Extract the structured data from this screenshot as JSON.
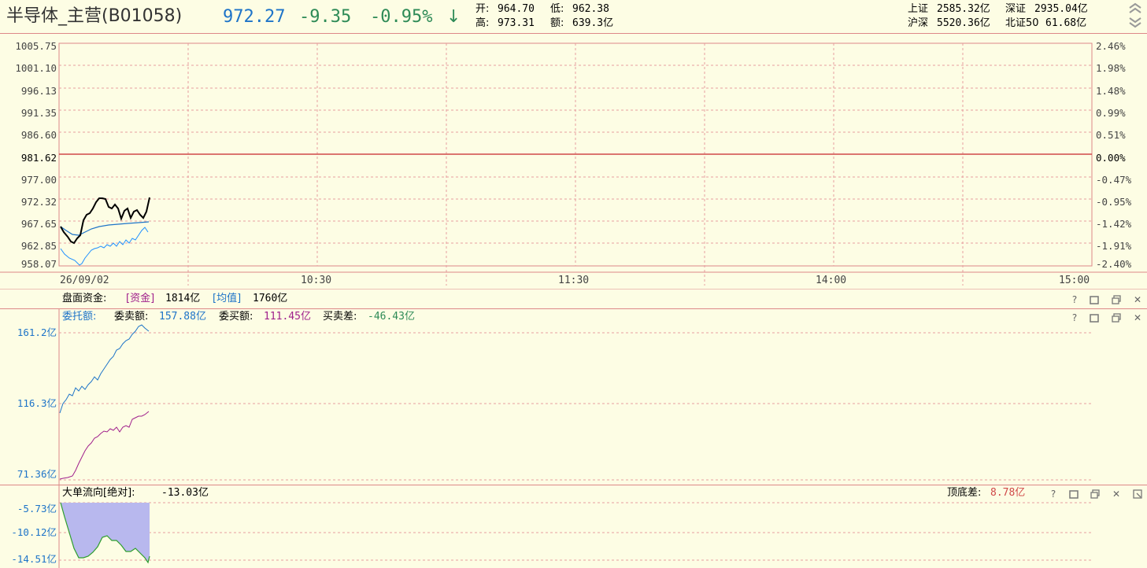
{
  "header": {
    "title": "半导体_主营(B01058)",
    "price": "972.27",
    "change": "-9.35",
    "pct": "-0.95%",
    "arrow": "↓",
    "open_label": "开:",
    "open_val": "964.70",
    "high_label": "高:",
    "high_val": "973.31",
    "low_label": "低:",
    "low_val": "962.38",
    "amount_label": "额:",
    "amount_val": "639.3亿",
    "markets": [
      {
        "name": "上证",
        "val": "2585.32亿"
      },
      {
        "name": "深证",
        "val": "2935.04亿"
      },
      {
        "name": "沪深",
        "val": "5520.36亿"
      },
      {
        "name": "北证50",
        "val": "61.68亿"
      }
    ],
    "up_icon": "chevron-double-up-icon",
    "down_icon": "chevron-double-down-icon"
  },
  "price_chart": {
    "left_ticks": [
      "1005.75",
      "1001.10",
      "996.13",
      "991.35",
      "986.60",
      "981.62",
      "977.00",
      "972.32",
      "967.65",
      "962.85",
      "958.07"
    ],
    "right_ticks": [
      "2.46%",
      "1.98%",
      "1.48%",
      "0.99%",
      "0.51%",
      "0.00%",
      "-0.47%",
      "-0.95%",
      "-1.42%",
      "-1.91%",
      "-2.40%"
    ],
    "time_labels": [
      "26/09/02",
      "10:30",
      "11:30",
      "14:00",
      "15:00"
    ],
    "colors": {
      "price": "#000000",
      "avg": "#1e74c8",
      "flow": "#1e90ff",
      "zero": "#d04848"
    }
  },
  "capital_bar": {
    "label": "盘面资金:",
    "fund_tag": "[资金]",
    "fund_val": "1814亿",
    "avg_tag": "[均值]",
    "avg_val": "1760亿"
  },
  "order_panel": {
    "label": "委托额:",
    "sell_label": "委卖额:",
    "sell_val": "157.88亿",
    "buy_label": "委买额:",
    "buy_val": "111.45亿",
    "diff_label": "买卖差:",
    "diff_val": "-46.43亿",
    "ticks": [
      "161.2亿",
      "116.3亿",
      "71.36亿"
    ],
    "colors": {
      "sell": "#1e74c8",
      "buy": "#a0208c"
    }
  },
  "bigflow_panel": {
    "label": "大单流向[绝对]:",
    "value": "-13.03亿",
    "spread_label": "顶底差:",
    "spread_val": "8.78亿",
    "ticks": [
      "-5.73亿",
      "-10.12亿",
      "-14.51亿"
    ],
    "colors": {
      "fill": "#b8b8ee",
      "line": "#2e9e2e"
    }
  },
  "panel_icons": [
    "help-icon",
    "restore-icon",
    "maximize-icon",
    "close-icon"
  ]
}
